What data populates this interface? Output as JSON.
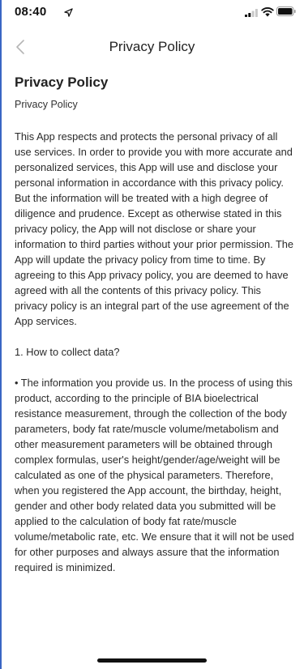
{
  "status_bar": {
    "time": "08:40"
  },
  "nav": {
    "title": "Privacy Policy",
    "back_icon": "chevron-left-icon"
  },
  "content": {
    "heading": "Privacy Policy",
    "subheading": "Privacy Policy",
    "intro": "This App respects and protects the personal privacy of all use services. In order to provide you with more accurate and personalized services, this App will use and disclose your personal information in accordance with this privacy policy. But the information will be treated with a high degree of diligence and prudence. Except as otherwise stated in this privacy policy, the App will not disclose or share your information to third parties without your prior permission. The App will update the privacy policy from time to time. By agreeing to this App privacy policy, you are deemed to have agreed with all the contents of this privacy policy. This privacy policy is an integral part of the use agreement of the App services.",
    "section1_title": "1. How to collect data?",
    "section1_body": "• The information you provide us. In the process of using this product, according to the principle of BIA bioelectrical resistance measurement, through the collection of the body parameters, body fat rate/muscle volume/metabolism and other measurement parameters will be obtained through complex formulas, user's height/gender/age/weight will be calculated as one of the physical parameters. Therefore, when you registered the App account, the birthday, height, gender and other body related data you submitted will be applied to the calculation of body fat rate/muscle volume/metabolic rate, etc. We ensure that it will not be used for other purposes and always assure that the information required is minimized."
  }
}
